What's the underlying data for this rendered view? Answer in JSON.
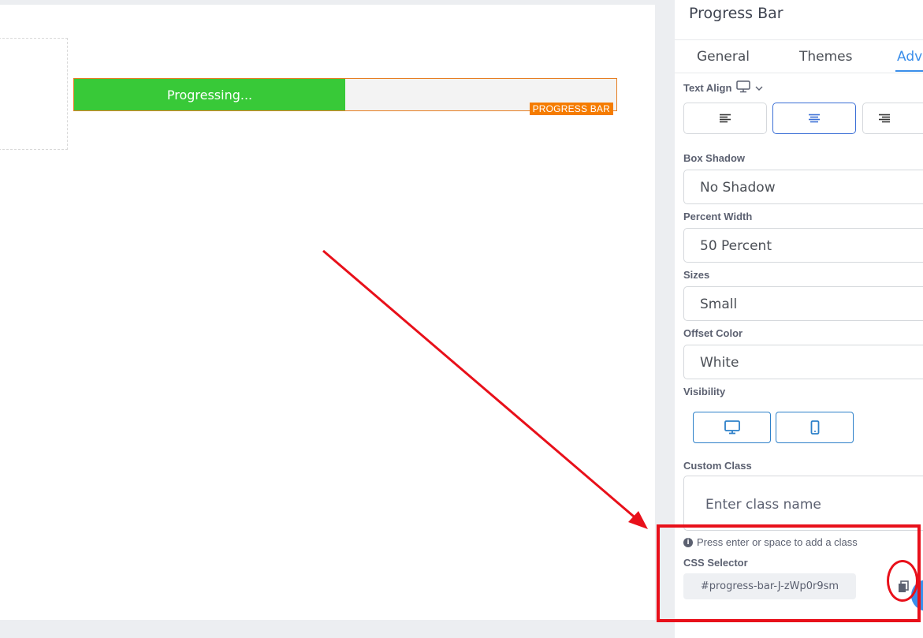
{
  "canvas": {
    "progress_bar": {
      "label": "Progressing...",
      "percent": 50,
      "fill_color": "#38c938",
      "track_color": "#f3f3f3",
      "tag": "PROGRESS BAR"
    }
  },
  "panel": {
    "title": "Progress Bar",
    "tabs": [
      {
        "label": "General"
      },
      {
        "label": "Themes"
      },
      {
        "label": "Adva",
        "active": true
      }
    ],
    "text_align": {
      "label": "Text Align",
      "device_icon": "monitor-icon",
      "active": "center"
    },
    "box_shadow": {
      "label": "Box Shadow",
      "value": "No Shadow"
    },
    "percent_width": {
      "label": "Percent Width",
      "value": "50 Percent"
    },
    "sizes": {
      "label": "Sizes",
      "value": "Small"
    },
    "offset_color": {
      "label": "Offset Color",
      "value": "White"
    },
    "visibility": {
      "label": "Visibility",
      "options": [
        "desktop-icon",
        "mobile-icon"
      ]
    },
    "custom_class": {
      "label": "Custom Class",
      "placeholder": "Enter class name",
      "hint": "Press enter or space to add a class"
    },
    "css_selector": {
      "label": "CSS Selector",
      "value": "#progress-bar-J-zWp0r9sm"
    }
  },
  "colors": {
    "accent": "#3b8eea",
    "annotation": "#e8101a",
    "tag": "#f57c00"
  }
}
